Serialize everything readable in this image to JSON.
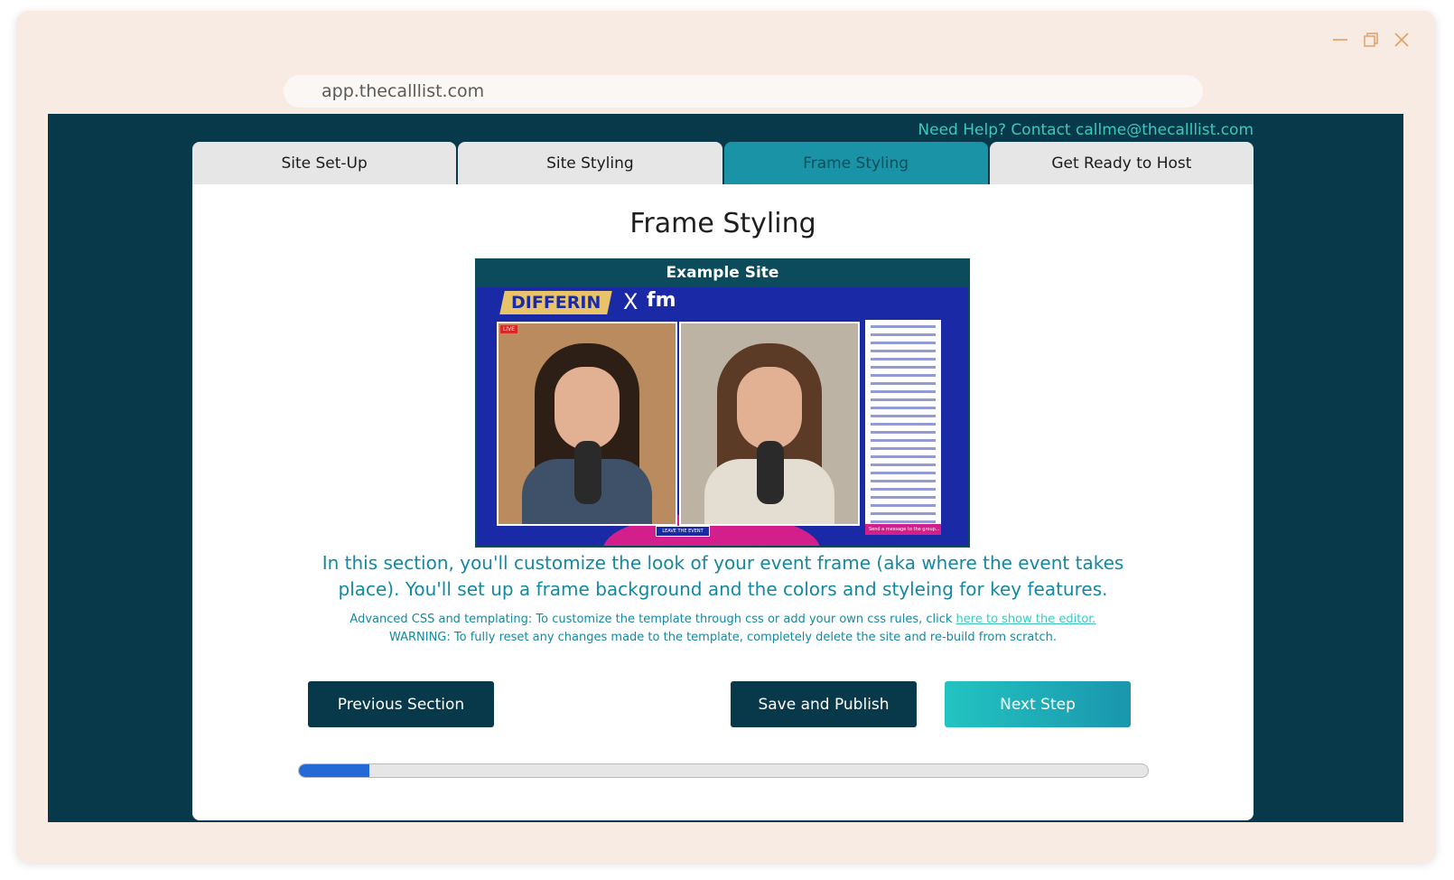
{
  "browser": {
    "url": "app.thecalllist.com"
  },
  "header": {
    "help_text": "Need Help? Contact callme@thecalllist.com"
  },
  "tabs": [
    {
      "label": "Site Set-Up"
    },
    {
      "label": "Site Styling"
    },
    {
      "label": "Frame Styling",
      "active": true
    },
    {
      "label": "Get Ready to Host"
    }
  ],
  "main": {
    "title": "Frame Styling",
    "example": {
      "heading": "Example Site",
      "brand": "DIFFERIN",
      "brand_x": "X",
      "brand_partner": "fm",
      "live_badge": "LIVE",
      "leave_label": "LEAVE THE EVENT",
      "chat_send": "Send a message to the group..."
    },
    "intro": "In this section, you'll customize the look of your event frame (aka where the event takes place). You'll set up a frame background and the colors and styleing for key features.",
    "advanced_prefix": "Advanced CSS and templating: To customize the template through css or add your own css rules, click ",
    "advanced_link": "here to show the editor.",
    "warning": "WARNING: To fully reset any changes made to the template, completely delete the site and re-build from scratch."
  },
  "buttons": {
    "previous": "Previous Section",
    "save": "Save and Publish",
    "next": "Next Step"
  },
  "progress": {
    "fraction": 0.083
  },
  "colors": {
    "app_bg": "#07394a",
    "accent": "#1b93a6",
    "help_text": "#3cc8c0",
    "progress_fill": "#2369d8"
  }
}
